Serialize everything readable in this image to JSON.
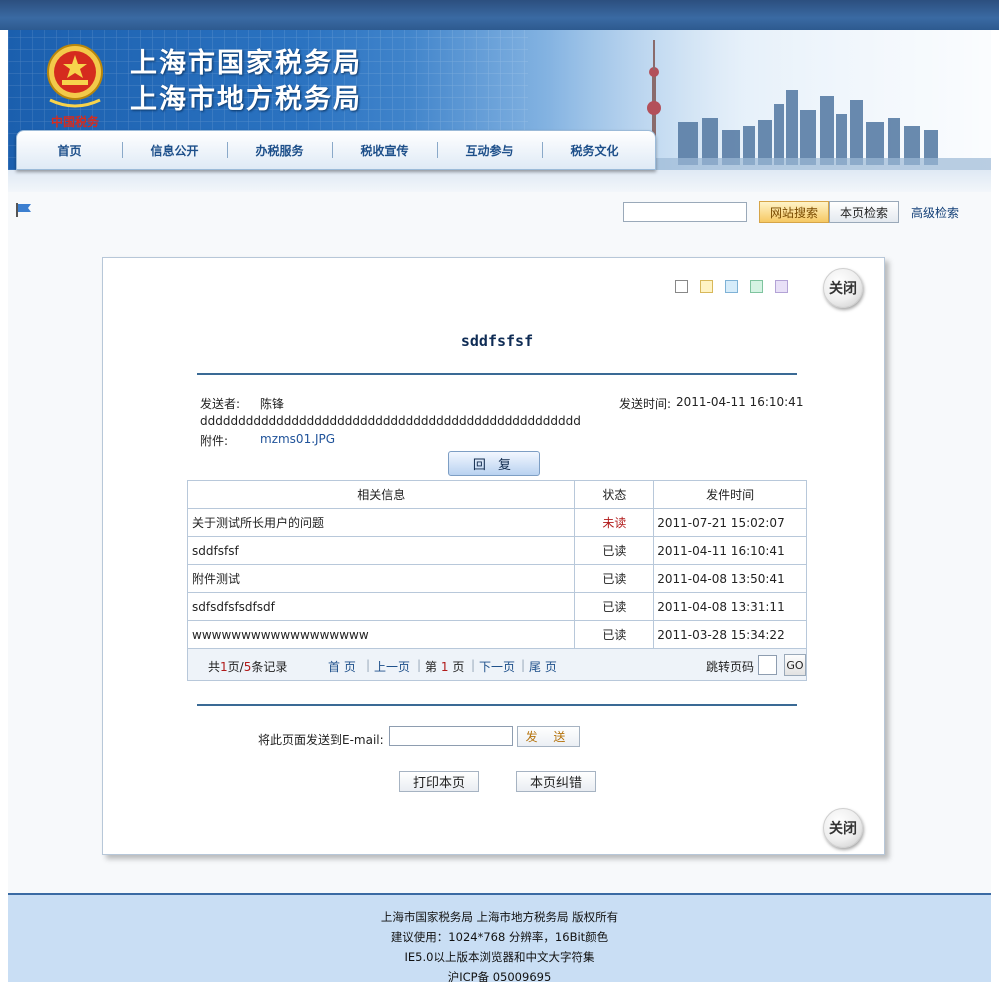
{
  "header": {
    "title_line1": "上海市国家税务局",
    "title_line2": "上海市地方税务局",
    "emblem_caption": "中国税务",
    "nav": [
      "首页",
      "信息公开",
      "办税服务",
      "税收宣传",
      "互动参与",
      "税务文化"
    ]
  },
  "search": {
    "site_search_label": "网站搜索",
    "page_search_label": "本页检索",
    "advanced_label": "高级检索"
  },
  "panel": {
    "theme_swatches": [
      "#ffffff",
      "#fff3c4",
      "#d6ecfa",
      "#d5f3e3",
      "#e8e0f7"
    ],
    "close_label": "关闭",
    "message_title": "sddfsfsf",
    "sender_label": "发送者:",
    "sender_name": "陈锋",
    "send_time_label": "发送时间:",
    "send_time": "2011-04-11 16:10:41",
    "body": "dddddddddddddddddddddddddddddddddddddddddddddddddd",
    "attachment_label": "附件:",
    "attachment_name": "mzms01.JPG",
    "reply_label": "回 复"
  },
  "table": {
    "headers": [
      "相关信息",
      "状态",
      "发件时间"
    ],
    "rows": [
      {
        "subject": "关于测试所长用户的问题",
        "status": "未读",
        "time": "2011-07-21 15:02:07"
      },
      {
        "subject": "sddfsfsf",
        "status": "已读",
        "time": "2011-04-11 16:10:41"
      },
      {
        "subject": "附件测试",
        "status": "已读",
        "time": "2011-04-08 13:50:41"
      },
      {
        "subject": "sdfsdfsfsdfsdf",
        "status": "已读",
        "time": "2011-04-08 13:31:11"
      },
      {
        "subject": "wwwwwwwwwwwwwwwwww",
        "status": "已读",
        "time": "2011-03-28 15:34:22"
      }
    ]
  },
  "pager": {
    "total_prefix": "共",
    "current_page": "1",
    "total_pages": "5",
    "page_word": "页/",
    "record_suffix": "条记录",
    "first": "首 页",
    "prev": "上一页",
    "page_prefix": "第",
    "page_suffix": "页",
    "next": "下一页",
    "last": "尾 页",
    "jump_label": "跳转页码",
    "go_label": "GO"
  },
  "actions": {
    "email_label": "将此页面发送到E-mail:",
    "send_label": "发 送",
    "print_label": "打印本页",
    "correct_label": "本页纠错"
  },
  "footer": {
    "line1": "上海市国家税务局  上海市地方税务局 版权所有",
    "line2": "建议使用：1024*768 分辨率，16Bit颜色",
    "line3": "IE5.0以上版本浏览器和中文大字符集",
    "line4": "沪ICP备 05009695"
  }
}
